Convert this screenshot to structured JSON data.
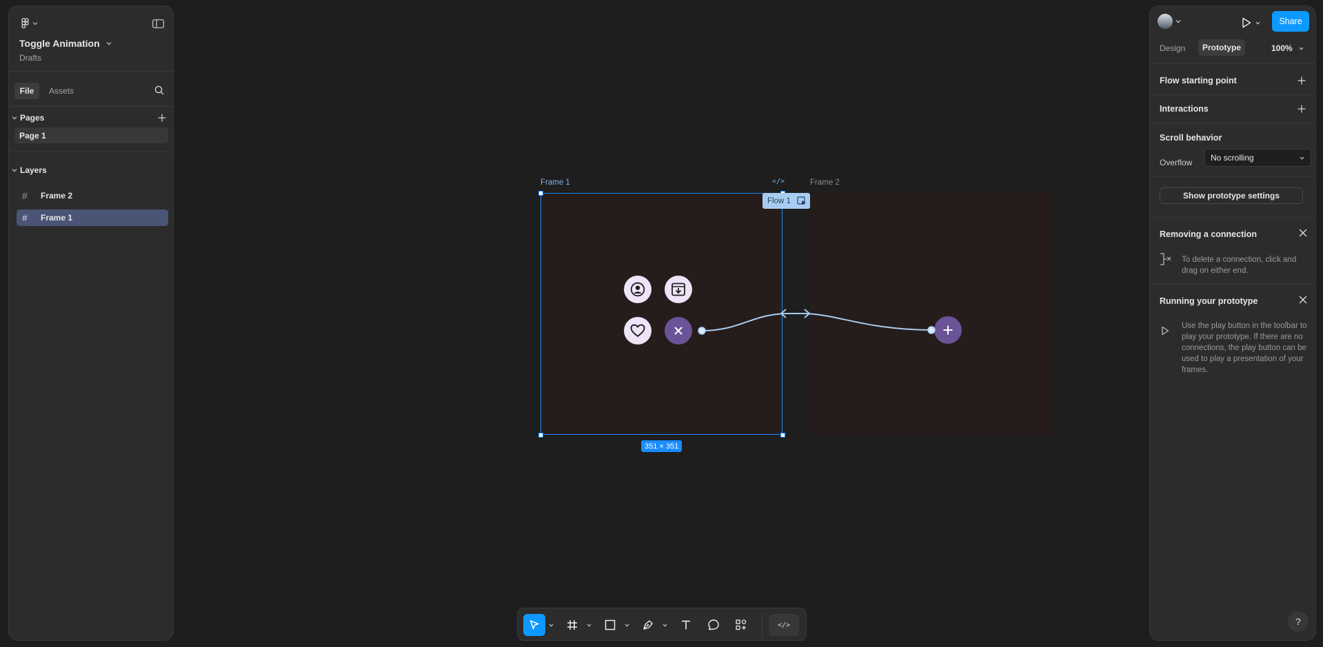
{
  "file": {
    "title": "Toggle Animation",
    "location": "Drafts"
  },
  "left_tabs": {
    "file": "File",
    "assets": "Assets"
  },
  "pages": {
    "header": "Pages",
    "items": [
      "Page 1"
    ]
  },
  "layers": {
    "header": "Layers",
    "items": [
      "Frame 2",
      "Frame 1"
    ]
  },
  "right_tabs": {
    "design": "Design",
    "prototype": "Prototype",
    "zoom": "100%"
  },
  "share_label": "Share",
  "prototype": {
    "flow_start": "Flow starting point",
    "interactions": "Interactions",
    "scroll_header": "Scroll behavior",
    "overflow_label": "Overflow",
    "overflow_value": "No scrolling",
    "settings_button": "Show prototype settings",
    "removing_title": "Removing a connection",
    "removing_text": "To delete a connection, click and drag on either end.",
    "running_title": "Running your prototype",
    "running_text": "Use the play button in the toolbar to play your prototype. If there are no connections, the play button can be used to play a presentation of your frames."
  },
  "canvas": {
    "frame1_label": "Frame 1",
    "frame2_label": "Frame 2",
    "flow_badge": "Flow 1",
    "size_badge": "351 × 351"
  },
  "colors": {
    "accent": "#0d99ff",
    "selection": "#1a8cff",
    "frame_fill": "#261c1c",
    "bubble_light": "#ede4f7",
    "bubble_dark": "#6a5396",
    "connector": "#a9cdf2"
  },
  "icons": [
    "figma-menu-icon",
    "sidebar-toggle-icon",
    "search-icon",
    "plus-icon",
    "frame-hash-icon",
    "avatar",
    "play-icon",
    "chevron-down-icon",
    "close-icon",
    "remove-connection-icon",
    "user-icon",
    "download-box-icon",
    "heart-icon",
    "x-icon",
    "add-icon",
    "move-tool-icon",
    "frame-tool-icon",
    "rectangle-tool-icon",
    "pen-tool-icon",
    "text-tool-icon",
    "comment-tool-icon",
    "actions-icon",
    "dev-mode-icon",
    "help-icon"
  ]
}
